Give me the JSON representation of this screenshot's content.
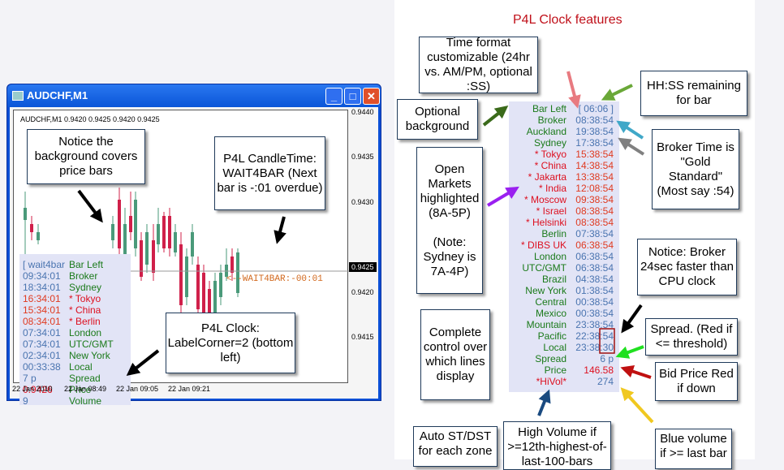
{
  "window": {
    "title": "AUDCHF,M1",
    "symbol_line": "AUDCHF,M1  0.9420 0.9425 0.9420 0.9425",
    "price_ticks": [
      "0.9440",
      "0.9435",
      "0.9430",
      "0.9425",
      "0.9420",
      "0.9415"
    ],
    "current_price": "0.9425",
    "date_ticks": [
      "22 Jan 2010",
      "22 Jan 08:49",
      "22 Jan 09:05",
      "22 Jan 09:21"
    ],
    "wait4bar": "<--WAIT4BAR:-00:01",
    "buttons": {
      "minimize": "_",
      "maximize": "□",
      "close": "✕"
    }
  },
  "left_clock": [
    {
      "t": "[ wait4bar",
      "n": "Bar Left",
      "tc": "blue"
    },
    {
      "t": "09:34:01",
      "n": "Broker",
      "tc": "blue"
    },
    {
      "t": "18:34:01",
      "n": "Sydney",
      "tc": "blue"
    },
    {
      "t": "16:34:01",
      "n": "* Tokyo",
      "tc": "orange",
      "nc": "red"
    },
    {
      "t": "15:34:01",
      "n": "* China",
      "tc": "orange",
      "nc": "red"
    },
    {
      "t": "08:34:01",
      "n": "* Berlin",
      "tc": "orange",
      "nc": "red"
    },
    {
      "t": "07:34:01",
      "n": "London",
      "tc": "blue"
    },
    {
      "t": "07:34:01",
      "n": "UTC/GMT",
      "tc": "blue"
    },
    {
      "t": "02:34:01",
      "n": "New York",
      "tc": "blue"
    },
    {
      "t": "00:33:38",
      "n": "Local",
      "tc": "blue"
    },
    {
      "t": "7 p",
      "n": "Spread",
      "tc": "blue"
    },
    {
      "t": "0.9426",
      "n": "Price",
      "tc": "red"
    },
    {
      "t": "9",
      "n": "Volume",
      "tc": "blue"
    }
  ],
  "left_callouts": {
    "background": "Notice the background covers price bars",
    "candletime": "P4L CandleTime: WAIT4BAR (Next bar is -:01 overdue)",
    "clock": "P4L Clock: LabelCorner=2 (bottom left)"
  },
  "right": {
    "title": "P4L Clock features",
    "clock": [
      {
        "n": "Bar Left",
        "v": "[ 06:06 ]",
        "nc": "green",
        "vc": "blue"
      },
      {
        "n": "Broker",
        "v": "08:38:54",
        "nc": "green",
        "vc": "blue"
      },
      {
        "n": "Auckland",
        "v": "19:38:54",
        "nc": "green",
        "vc": "blue"
      },
      {
        "n": "Sydney",
        "v": "17:38:54",
        "nc": "green",
        "vc": "blue"
      },
      {
        "n": "* Tokyo",
        "v": "15:38:54",
        "nc": "red",
        "vc": "orange"
      },
      {
        "n": "* China",
        "v": "14:38:54",
        "nc": "red",
        "vc": "orange"
      },
      {
        "n": "* Jakarta",
        "v": "13:38:54",
        "nc": "red",
        "vc": "orange"
      },
      {
        "n": "* India",
        "v": "12:08:54",
        "nc": "red",
        "vc": "orange"
      },
      {
        "n": "* Moscow",
        "v": "09:38:54",
        "nc": "red",
        "vc": "orange"
      },
      {
        "n": "* Israel",
        "v": "08:38:54",
        "nc": "red",
        "vc": "orange"
      },
      {
        "n": "* Helsinki",
        "v": "08:38:54",
        "nc": "red",
        "vc": "orange"
      },
      {
        "n": "Berlin",
        "v": "07:38:54",
        "nc": "green",
        "vc": "blue"
      },
      {
        "n": "* DIBS UK",
        "v": "06:38:54",
        "nc": "red",
        "vc": "orange"
      },
      {
        "n": "London",
        "v": "06:38:54",
        "nc": "green",
        "vc": "blue"
      },
      {
        "n": "UTC/GMT",
        "v": "06:38:54",
        "nc": "green",
        "vc": "blue"
      },
      {
        "n": "Brazil",
        "v": "04:38:54",
        "nc": "green",
        "vc": "blue"
      },
      {
        "n": "New York",
        "v": "01:38:54",
        "nc": "green",
        "vc": "blue"
      },
      {
        "n": "Central",
        "v": "00:38:54",
        "nc": "green",
        "vc": "blue"
      },
      {
        "n": "Mexico",
        "v": "00:38:54",
        "nc": "green",
        "vc": "blue"
      },
      {
        "n": "Mountain",
        "v": "23:38:54",
        "nc": "green",
        "vc": "blue"
      },
      {
        "n": "Pacific",
        "v": "22:38:54",
        "nc": "green",
        "vc": "blue"
      },
      {
        "n": "Local",
        "v": "23:38:30",
        "nc": "green",
        "vc": "blue"
      },
      {
        "n": "Spread",
        "v": "6 p",
        "nc": "green",
        "vc": "blue"
      },
      {
        "n": "Price",
        "v": "146.58",
        "nc": "green",
        "vc": "red"
      },
      {
        "n": "*HiVol*",
        "v": "274",
        "nc": "red",
        "vc": "blue"
      }
    ],
    "callouts": {
      "time_format": "Time format customizable (24hr vs. AM/PM, optional :SS)",
      "hhss": "HH:SS remaining for bar",
      "optional_bg": "Optional background",
      "broker_time": "Broker Time is \"Gold Standard\" (Most say :54)",
      "open_markets": "Open Markets highlighted (8A-5P)",
      "open_markets_note": "(Note: Sydney is 7A-4P)",
      "broker_faster": "Notice: Broker 24sec faster than CPU clock",
      "spread": "Spread. (Red if <= threshold)",
      "complete_control": "Complete control over which lines display",
      "bid_price": "Bid Price Red if down",
      "auto_dst": "Auto ST/DST for each zone",
      "high_volume": "High Volume if >=12th-highest-of-last-100-bars",
      "blue_volume": "Blue volume if >= last bar"
    }
  },
  "colors": {
    "title_bar": "#0a55d8",
    "clock_bg": "#e2e4f6",
    "green": "#1a7a1a",
    "red": "#dd1020",
    "blue": "#4a74b0",
    "bull": "#4a9a7a",
    "bear": "#d0204a"
  }
}
